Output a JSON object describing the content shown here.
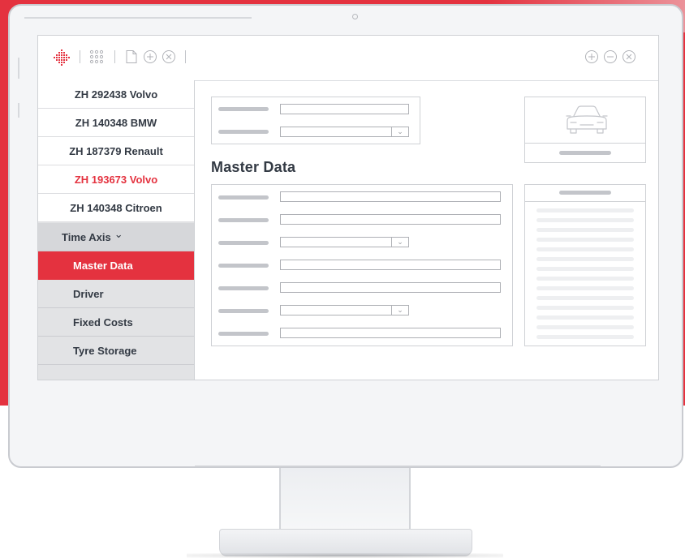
{
  "toolbar": {
    "left_icons": [
      "logo-icon",
      "grid-icon",
      "document-icon",
      "plus-circle-icon",
      "close-circle-icon"
    ],
    "right_icons": [
      "plus-circle-icon",
      "minus-circle-icon",
      "close-circle-icon"
    ]
  },
  "sidebar": {
    "vehicles": [
      {
        "label": "ZH 292438 Volvo",
        "active": false
      },
      {
        "label": "ZH 140348 BMW",
        "active": false
      },
      {
        "label": "ZH 187379 Renault",
        "active": false
      },
      {
        "label": "ZH 193673 Volvo",
        "active": true
      },
      {
        "label": "ZH 140348 Citroen",
        "active": false
      }
    ],
    "section_label": "Time Axis",
    "section_chevron": "⌄",
    "items": [
      {
        "label": "Master Data",
        "active": true
      },
      {
        "label": "Driver",
        "active": false
      },
      {
        "label": "Fixed Costs",
        "active": false
      },
      {
        "label": "Tyre Storage",
        "active": false
      }
    ]
  },
  "main": {
    "heading": "Master Data",
    "dropdown_arrow": "⌄",
    "vehicle_image_icon": "car-icon"
  },
  "colors": {
    "accent": "#e4323f",
    "text": "#333a44",
    "sidebar_bg": "#e2e3e5"
  }
}
